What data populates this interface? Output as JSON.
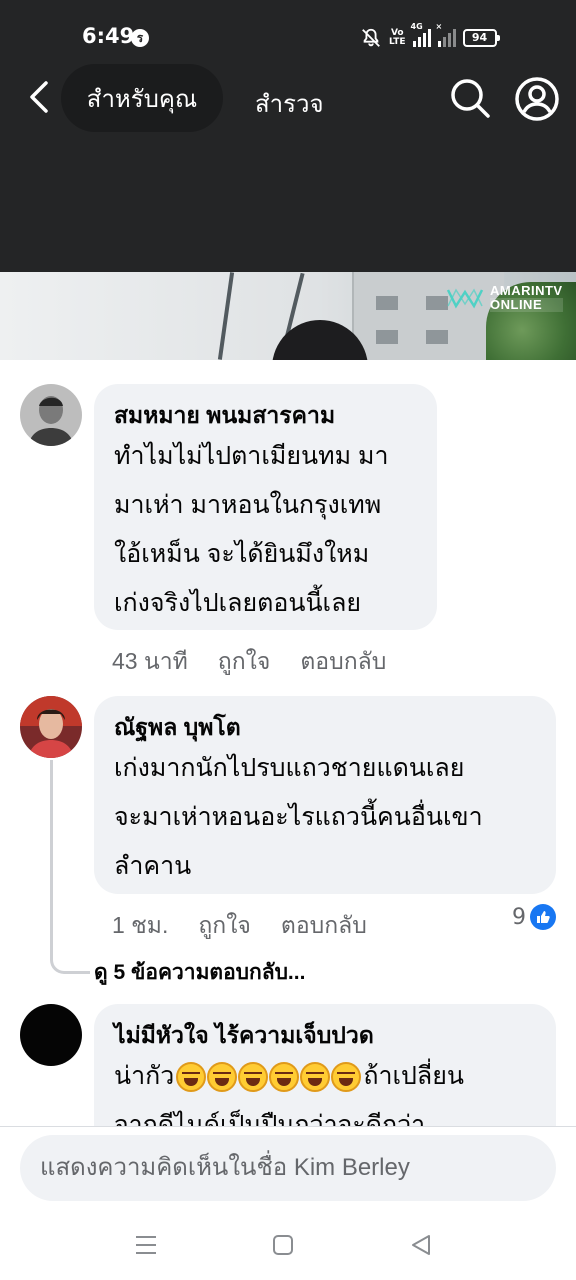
{
  "status_bar": {
    "time": "6:49",
    "notification_badge": "ร",
    "network_volte": "Vo\nLTE",
    "network_4g": "4G",
    "battery": "94"
  },
  "header": {
    "tabs": [
      {
        "label": "สำหรับคุณ",
        "active": true
      },
      {
        "label": "สำรวจ",
        "active": false
      }
    ],
    "icons": [
      "back-arrow-icon",
      "search-icon",
      "profile-icon"
    ]
  },
  "video": {
    "watermark_line1": "AMARINTV",
    "watermark_line2": "ONLINE"
  },
  "comments": [
    {
      "author": "สมหมาย พนมสารคาม",
      "lines": [
        "ทำไมไม่ไปตาเมียนทม มา",
        "มาเห่า มาหอนในกรุงเทพ",
        "ใอ้เหม็น จะได้ยินมึงใหม",
        "เก่งจริงไปเลยตอนนี้เลย"
      ],
      "time": "43 นาที",
      "like_label": "ถูกใจ",
      "reply_label": "ตอบกลับ"
    },
    {
      "author": "ณัฐพล บุพโต",
      "lines": [
        "เก่งมากนักไปรบแถวชายแดนเลย",
        "จะมาเห่าหอนอะไรแถวนี้คนอื่นเขา",
        "ลำคาน"
      ],
      "time": "1 ชม.",
      "like_label": "ถูกใจ",
      "reply_label": "ตอบกลับ",
      "reaction_count": "9",
      "view_replies": "ดู 5 ข้อความตอบกลับ..."
    },
    {
      "author": "ไม่มีหัวใจ ไร้ความเจ็บปวด",
      "line1_prefix": "น่ากัว",
      "line1_suffix": "ถ้าเปลี่ยน",
      "line2": "จากดีไนด์เป็นปืนกว่าจะดีกว่า"
    }
  ],
  "composer": {
    "placeholder": "แสดงความคิดเห็นในชื่อ Kim Berley"
  },
  "colors": {
    "header_bg": "#242526",
    "bubble_bg": "#f0f2f5",
    "like_blue": "#1877f2",
    "meta_gray": "#65676b"
  }
}
